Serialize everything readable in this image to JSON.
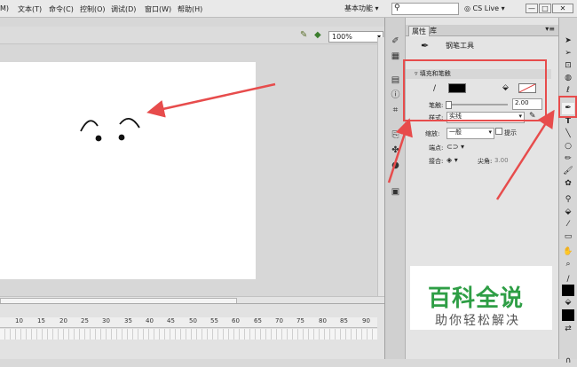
{
  "menubar": {
    "items": [
      "M)",
      "文本(T)",
      "命令(C)",
      "控制(O)",
      "调试(D)",
      "窗口(W)",
      "帮助(H)"
    ],
    "workspace": "基本功能",
    "cs_live": "CS Live",
    "search_placeholder": "",
    "window_buttons": [
      "—",
      "□",
      "✕"
    ]
  },
  "stage": {
    "zoom": "100%"
  },
  "timeline": {
    "ticks": [
      "10",
      "15",
      "20",
      "25",
      "30",
      "35",
      "40",
      "45",
      "50",
      "55",
      "60",
      "65",
      "70",
      "75",
      "80",
      "85",
      "90"
    ]
  },
  "properties": {
    "tabs": [
      "属性",
      "库"
    ],
    "tool_name": "钢笔工具",
    "fill_stroke_label": "填充和笔触",
    "stroke_label": "笔触:",
    "stroke_value": "2.00",
    "style_label": "样式:",
    "style_value": "实线",
    "scale_label": "缩放:",
    "scale_value": "一般",
    "hint_label": "提示",
    "cap_label": "端点:",
    "join_label": "接合:",
    "miter_label": "尖角:",
    "miter_value": "3.00",
    "stroke_color": "#000000",
    "fill_color": "#ffffff"
  },
  "watermark": {
    "title": "百科全说",
    "subtitle": "助你轻松解决",
    "title_color": "#2e9e45"
  },
  "colors": {
    "annotation_red": "#e74c4c",
    "canvas": "#ffffff"
  }
}
